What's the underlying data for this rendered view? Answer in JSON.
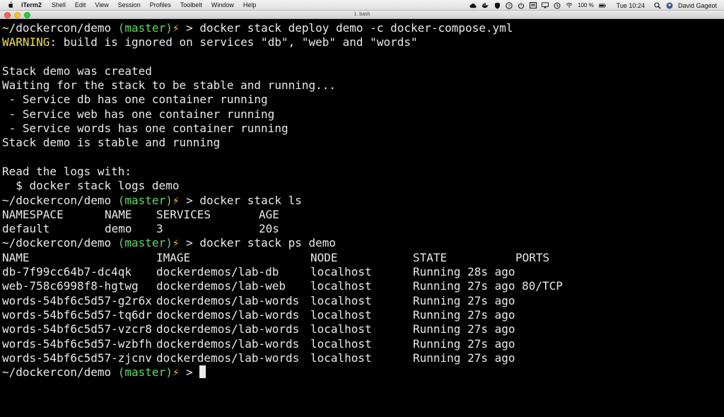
{
  "menubar": {
    "app_name": "iTerm2",
    "items": [
      "Shell",
      "Edit",
      "View",
      "Session",
      "Profiles",
      "Toolbelt",
      "Window",
      "Help"
    ],
    "battery": "100 %",
    "clock": "Tue 10:24",
    "user": "David Gageot"
  },
  "window": {
    "title": "1. bash"
  },
  "terminal": {
    "prompt_path": "~/dockercon/demo ",
    "prompt_branch": "(master)",
    "prompt_bolt": "⚡",
    "prompt_arrow": " > ",
    "cmd_deploy": "docker stack deploy demo -c docker-compose.yml",
    "warning_label": "WARNING",
    "warning_text": ": build is ignored on services \"db\", \"web\" and \"words\"",
    "out_created": "Stack demo was created",
    "out_waiting": "Waiting for the stack to be stable and running...",
    "out_svc_db": " - Service db has one container running",
    "out_svc_web": " - Service web has one container running",
    "out_svc_words": " - Service words has one container running",
    "out_stable": "Stack demo is stable and running",
    "out_read_logs": "Read the logs with:",
    "out_logs_cmd": "  $ docker stack logs demo",
    "cmd_ls": "docker stack ls",
    "ls_headers": [
      "NAMESPACE",
      "NAME",
      "SERVICES",
      "AGE"
    ],
    "ls_row": [
      "default",
      "demo",
      "3",
      "20s"
    ],
    "cmd_ps": "docker stack ps demo",
    "ps_headers": [
      "NAME",
      "IMAGE",
      "NODE",
      "STATE",
      "PORTS"
    ],
    "ps_rows": [
      [
        "db-7f99cc64b7-dc4qk",
        "dockerdemos/lab-db",
        "localhost",
        "Running 28s ago",
        ""
      ],
      [
        "web-758c6998f8-hgtwg",
        "dockerdemos/lab-web",
        "localhost",
        "Running 27s ago",
        "80/TCP"
      ],
      [
        "words-54bf6c5d57-g2r6x",
        "dockerdemos/lab-words",
        "localhost",
        "Running 27s ago",
        ""
      ],
      [
        "words-54bf6c5d57-tq6dr",
        "dockerdemos/lab-words",
        "localhost",
        "Running 27s ago",
        ""
      ],
      [
        "words-54bf6c5d57-vzcr8",
        "dockerdemos/lab-words",
        "localhost",
        "Running 27s ago",
        ""
      ],
      [
        "words-54bf6c5d57-wzbfh",
        "dockerdemos/lab-words",
        "localhost",
        "Running 27s ago",
        ""
      ],
      [
        "words-54bf6c5d57-zjcnv",
        "dockerdemos/lab-words",
        "localhost",
        "Running 27s ago",
        ""
      ]
    ]
  }
}
